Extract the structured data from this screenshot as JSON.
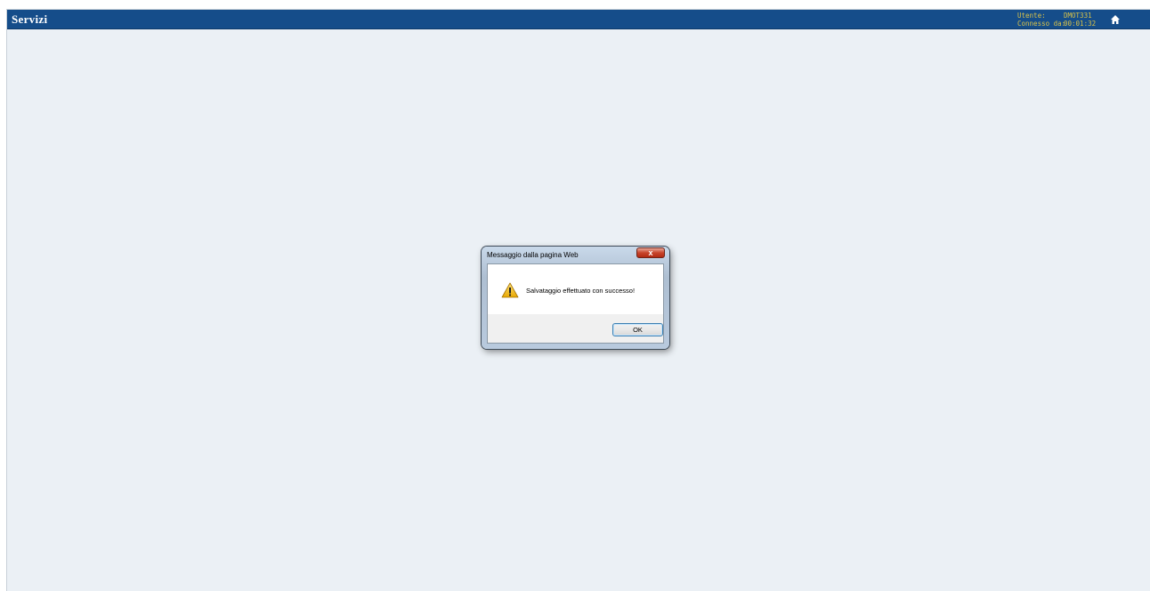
{
  "header": {
    "title": "Servizi",
    "user_label": "Utente:",
    "user_value": "DMOT331",
    "connected_label": "Connesso da:",
    "connected_value": "00:01:32",
    "home_icon": "home-icon",
    "bar_color": "#154d8a",
    "info_color": "#d8c24a"
  },
  "dialog": {
    "title": "Messaggio dalla pagina Web",
    "close_label": "x",
    "message": "Salvataggio effettuato con successo!",
    "icon": "warning-icon",
    "ok_label": "OK"
  },
  "colors": {
    "background": "#ebf0f5"
  }
}
